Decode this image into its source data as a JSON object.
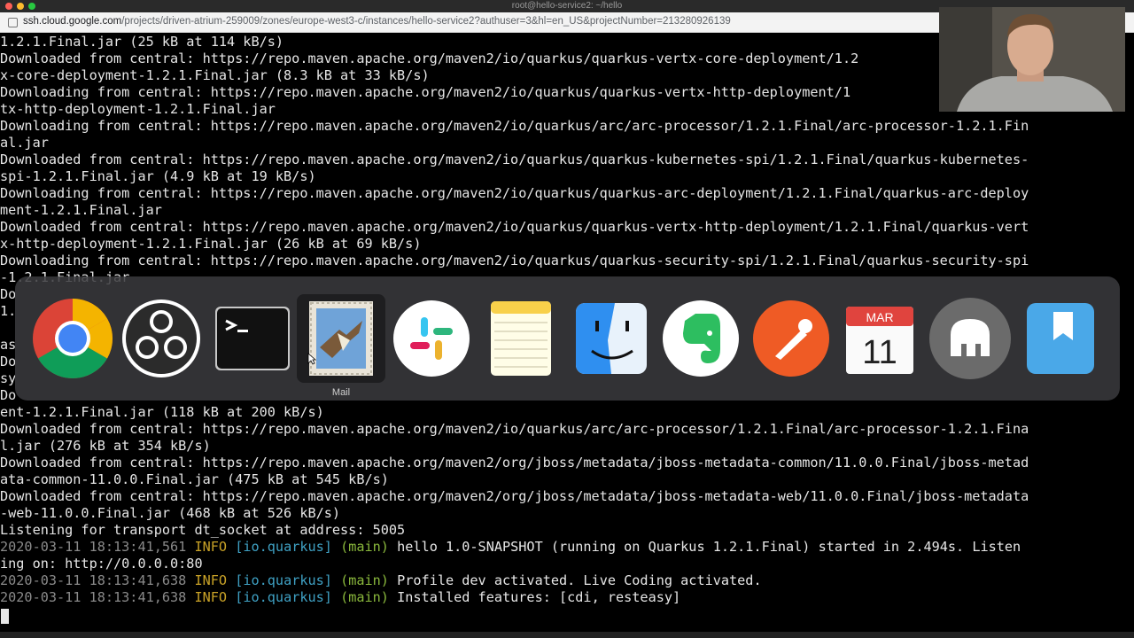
{
  "window": {
    "title": "root@hello-service2: ~/hello",
    "traffic_lights": [
      "#fe5f57",
      "#febc2e",
      "#28c840"
    ]
  },
  "browser": {
    "url_host": "ssh.cloud.google.com",
    "url_path": "/projects/driven-atrium-259009/zones/europe-west3-c/instances/hello-service2?authuser=3&hl=en_US&projectNumber=213280926139"
  },
  "terminal": {
    "lines": [
      "1.2.1.Final.jar (25 kB at 114 kB/s)",
      "Downloaded from central: https://repo.maven.apache.org/maven2/io/quarkus/quarkus-vertx-core-deployment/1.2",
      "x-core-deployment-1.2.1.Final.jar (8.3 kB at 33 kB/s)",
      "Downloading from central: https://repo.maven.apache.org/maven2/io/quarkus/quarkus-vertx-http-deployment/1",
      "tx-http-deployment-1.2.1.Final.jar",
      "Downloading from central: https://repo.maven.apache.org/maven2/io/quarkus/arc/arc-processor/1.2.1.Final/arc-processor-1.2.1.Fin",
      "al.jar",
      "Downloaded from central: https://repo.maven.apache.org/maven2/io/quarkus/quarkus-kubernetes-spi/1.2.1.Final/quarkus-kubernetes-",
      "spi-1.2.1.Final.jar (4.9 kB at 19 kB/s)",
      "Downloading from central: https://repo.maven.apache.org/maven2/io/quarkus/quarkus-arc-deployment/1.2.1.Final/quarkus-arc-deploy",
      "ment-1.2.1.Final.jar",
      "Downloaded from central: https://repo.maven.apache.org/maven2/io/quarkus/quarkus-vertx-http-deployment/1.2.1.Final/quarkus-vert",
      "x-http-deployment-1.2.1.Final.jar (26 kB at 69 kB/s)",
      "Downloading from central: https://repo.maven.apache.org/maven2/io/quarkus/quarkus-security-spi/1.2.1.Final/quarkus-security-spi",
      "-1.2.1.Final.jar",
      "Do",
      "1.",
      "",
      "as",
      "Do",
      "sy",
      "Do",
      "ent-1.2.1.Final.jar (118 kB at 200 kB/s)",
      "Downloaded from central: https://repo.maven.apache.org/maven2/io/quarkus/arc/arc-processor/1.2.1.Final/arc-processor-1.2.1.Fina",
      "l.jar (276 kB at 354 kB/s)",
      "Downloaded from central: https://repo.maven.apache.org/maven2/org/jboss/metadata/jboss-metadata-common/11.0.0.Final/jboss-metad",
      "ata-common-11.0.0.Final.jar (475 kB at 545 kB/s)",
      "Downloaded from central: https://repo.maven.apache.org/maven2/org/jboss/metadata/jboss-metadata-web/11.0.0.Final/jboss-metadata",
      "-web-11.0.0.Final.jar (468 kB at 526 kB/s)",
      "Listening for transport dt_socket at address: 5005"
    ],
    "log_lines": [
      {
        "ts": "2020-03-11 18:13:41,561",
        "level": "INFO",
        "cat": "[io.quarkus]",
        "thread": "(main)",
        "msg": "hello 1.0-SNAPSHOT (running on Quarkus 1.2.1.Final) started in 2.494s. Listen"
      },
      {
        "cont": "ing on: http://0.0.0.0:80"
      },
      {
        "ts": "2020-03-11 18:13:41,638",
        "level": "INFO",
        "cat": "[io.quarkus]",
        "thread": "(main)",
        "msg": "Profile dev activated. Live Coding activated."
      },
      {
        "ts": "2020-03-11 18:13:41,638",
        "level": "INFO",
        "cat": "[io.quarkus]",
        "thread": "(main)",
        "msg": "Installed features: [cdi, resteasy]"
      }
    ]
  },
  "app_switcher": {
    "apps": [
      {
        "name": "chrome",
        "icon": "chrome-icon"
      },
      {
        "name": "obs",
        "icon": "obs-icon"
      },
      {
        "name": "terminal",
        "icon": "terminal-icon"
      },
      {
        "name": "mail",
        "icon": "mail-icon",
        "selected": true
      },
      {
        "name": "slack",
        "icon": "slack-icon"
      },
      {
        "name": "notes",
        "icon": "notes-icon"
      },
      {
        "name": "finder",
        "icon": "finder-icon"
      },
      {
        "name": "evernote",
        "icon": "evernote-icon"
      },
      {
        "name": "postman",
        "icon": "postman-icon"
      },
      {
        "name": "calendar",
        "icon": "calendar-icon"
      },
      {
        "name": "tableplus",
        "icon": "elephant-icon"
      },
      {
        "name": "day-one",
        "icon": "bookmark-icon"
      }
    ],
    "selected_label": "Mail",
    "calendar_month": "MAR",
    "calendar_day": "11"
  }
}
